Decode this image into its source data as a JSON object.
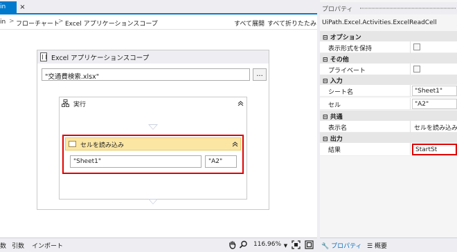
{
  "tab": {
    "label": "in",
    "close": "×"
  },
  "breadcrumb": {
    "items": [
      "in",
      "フローチャート",
      "Excel アプリケーションスコープ"
    ],
    "separator": ">"
  },
  "toolbar": {
    "expand_all": "すべて展開",
    "collapse_all": "すべて折りたたみ"
  },
  "scope": {
    "title": "Excel アプリケーションスコープ",
    "path": "\"交通費検索.xlsx\"",
    "browse": "..."
  },
  "do_sequence": {
    "title": "実行",
    "collapse": "⌃"
  },
  "read_cell": {
    "title": "セルを読み込み",
    "collapse": "⌃",
    "sheet": "\"Sheet1\"",
    "cell": "\"A2\""
  },
  "designer_footer": {
    "tabs": [
      "数",
      "引数",
      "インポート"
    ],
    "zoom": "116.96%"
  },
  "properties": {
    "title": "プロパティ",
    "type_name": "UiPath.Excel.Activities.ExcelReadCell",
    "categories": {
      "options": "オプション",
      "misc": "その他",
      "input": "入力",
      "common": "共通",
      "output": "出力"
    },
    "rows": {
      "preserve_format": "表示形式を保持",
      "private": "プライベート",
      "sheet_name": "シート名",
      "sheet_value": "\"Sheet1\"",
      "cell": "セル",
      "cell_value": "\"A2\"",
      "display_name": "表示名",
      "display_value": "セルを読み込み",
      "result": "結果",
      "result_value": "StartSt"
    },
    "bottom_tabs": {
      "properties": "プロパティ",
      "outline": "概要"
    }
  },
  "colors": {
    "accent": "#007acc",
    "highlight": "#e00000",
    "activity_header": "#fbe6a4"
  }
}
